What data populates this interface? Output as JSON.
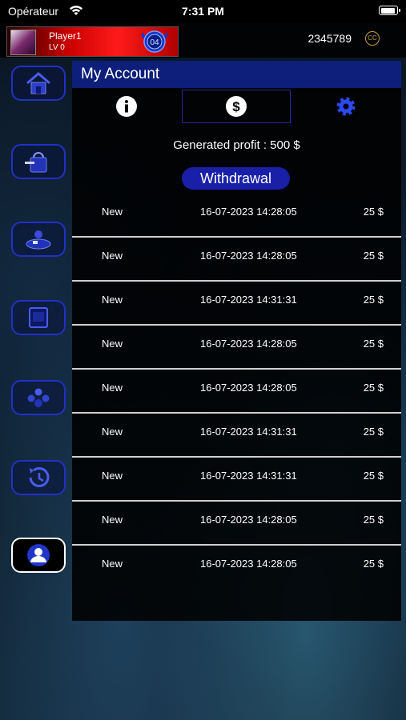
{
  "status_bar": {
    "carrier": "Opérateur",
    "time": "7:31 PM"
  },
  "header": {
    "player_name": "Player1",
    "player_level": "LV 0",
    "coins": "2345789",
    "coin_symbol": "CC"
  },
  "sidebar": {
    "items": [
      {
        "name": "home"
      },
      {
        "name": "shop"
      },
      {
        "name": "poker"
      },
      {
        "name": "slots"
      },
      {
        "name": "players"
      },
      {
        "name": "history"
      },
      {
        "name": "account",
        "active": true
      }
    ]
  },
  "panel": {
    "title": "My Account",
    "tabs": [
      "info",
      "earnings",
      "settings"
    ],
    "selected_tab": "earnings",
    "profit_text": "Generated profit : 500 $",
    "withdraw_label": "Withdrawal",
    "rows": [
      {
        "status": "New",
        "date": "16-07-2023 14:28:05",
        "amount": "25 $"
      },
      {
        "status": "New",
        "date": "16-07-2023 14:28:05",
        "amount": "25 $"
      },
      {
        "status": "New",
        "date": "16-07-2023 14:31:31",
        "amount": "25 $"
      },
      {
        "status": "New",
        "date": "16-07-2023 14:28:05",
        "amount": "25 $"
      },
      {
        "status": "New",
        "date": "16-07-2023 14:28:05",
        "amount": "25 $"
      },
      {
        "status": "New",
        "date": "16-07-2023 14:31:31",
        "amount": "25 $"
      },
      {
        "status": "New",
        "date": "16-07-2023 14:31:31",
        "amount": "25 $"
      },
      {
        "status": "New",
        "date": "16-07-2023 14:28:05",
        "amount": "25 $"
      },
      {
        "status": "New",
        "date": "16-07-2023 14:28:05",
        "amount": "25 $"
      }
    ]
  },
  "colors": {
    "accent": "#1a1fa8",
    "header_bar": "#0d1f7a",
    "player_card": "#d00000"
  }
}
